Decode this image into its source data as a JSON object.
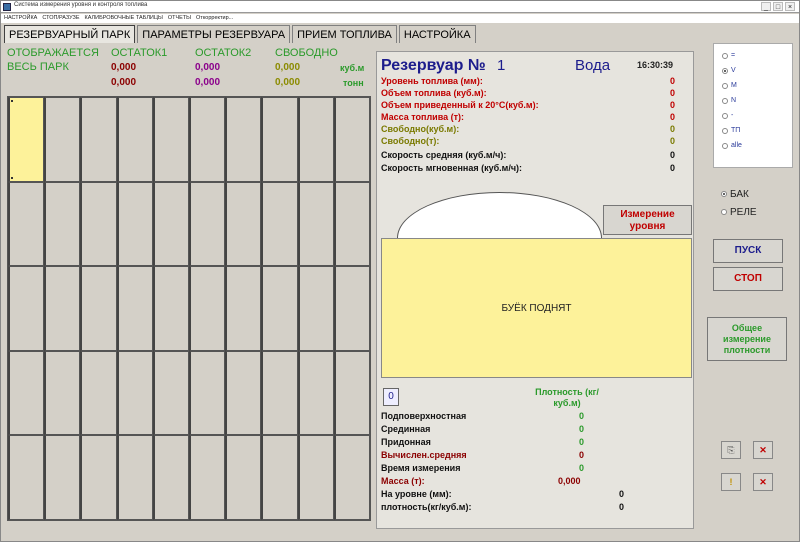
{
  "window": {
    "title": "Система измерения уровня и контроля топлива"
  },
  "menu": [
    "НАСТРОЙКА",
    "СТОП/РАЗУЗЕ",
    "КАЛИБРОВОЧНЫЕ ТАБЛИЦЫ",
    "ОТЧЕТЫ",
    "Откорректир..."
  ],
  "window_buttons": {
    "min": "_",
    "max": "□",
    "close": "×"
  },
  "tabs": [
    {
      "label": "РЕЗЕРВУАРНЫЙ ПАРК",
      "active": true
    },
    {
      "label": "ПАРАМЕТРЫ РЕЗЕРВУАРА",
      "active": false
    },
    {
      "label": "ПРИЕМ ТОПЛИВА",
      "active": false
    },
    {
      "label": "НАСТРОЙКА",
      "active": false
    }
  ],
  "summary": {
    "display_label": "ОТОБРАЖАЕТСЯ",
    "scope_label": "ВЕСЬ ПАРК",
    "col1": "ОСТАТОК1",
    "col2": "ОСТАТОК2",
    "col3": "СВОБОДНО",
    "row1": {
      "v1": "0,000",
      "v2": "0,000",
      "v3": "0,000",
      "unit": "куб.м"
    },
    "row2": {
      "v1": "0,000",
      "v2": "0,000",
      "v3": "0,000",
      "unit": "тонн"
    }
  },
  "grid": {
    "selected_index": 0
  },
  "reservoir": {
    "label": "Резервуар №",
    "number": "1",
    "product": "Вода",
    "time": "16:30:39",
    "params": [
      {
        "label": "Уровень топлива (мм):",
        "value": "0",
        "color": "red"
      },
      {
        "label": "Объем топлива (куб.м):",
        "value": "0",
        "color": "red"
      },
      {
        "label": "Объем приведенный к 20°С(куб.м):",
        "value": "0",
        "color": "red"
      },
      {
        "label": "Масса топлива (т):",
        "value": "0",
        "color": "red"
      },
      {
        "label": "Свободно(куб.м):",
        "value": "0",
        "color": "olive"
      },
      {
        "label": "Свободно(т):",
        "value": "0",
        "color": "olive"
      },
      {
        "label": "Скорость средняя (куб.м/ч):",
        "value": "0",
        "color": "black"
      },
      {
        "label": "Скорость мгновенная (куб.м/ч):",
        "value": "0",
        "color": "black"
      }
    ],
    "measure_button": "Измерение уровня",
    "tank_status": "БУЁК ПОДНЯТ"
  },
  "density": {
    "selector_value": "0",
    "header": "Плотность (кг/куб.м)",
    "rows": [
      {
        "label": "Подповерхностная",
        "value": "0",
        "color": "black"
      },
      {
        "label": "Срединная",
        "value": "0",
        "color": "black"
      },
      {
        "label": "Придонная",
        "value": "0",
        "color": "black"
      },
      {
        "label": "Вычислен.средняя",
        "value": "0",
        "color": "darkred"
      },
      {
        "label": "Время измерения",
        "value": "0",
        "color": "black"
      }
    ],
    "mass_label": "Масса (т):",
    "mass_value": "0,000",
    "level_label": "На уровне (мм):",
    "level_value": "0",
    "density_label": "плотность(кг/куб.м):",
    "density_value": "0"
  },
  "radio_options": [
    {
      "label": "=",
      "checked": false
    },
    {
      "label": "V",
      "checked": true
    },
    {
      "label": "M",
      "checked": false
    },
    {
      "label": "N",
      "checked": false
    },
    {
      "label": "-",
      "checked": false
    },
    {
      "label": "ТП",
      "checked": false
    },
    {
      "label": "alle",
      "checked": false
    }
  ],
  "mode": {
    "option1": "БАК",
    "option2": "РЕЛЕ",
    "selected": "option1"
  },
  "buttons": {
    "start": "ПУСК",
    "stop": "СТОП",
    "general_density": "Общее измерение плотности",
    "small_a": "⎘",
    "small_b": "✕",
    "small_c": "!",
    "small_d": "✕"
  },
  "colors": {
    "green": "#2b9a2b",
    "red": "#c00000",
    "navy": "#1c1c8c",
    "tank_yellow": "#fdf29a"
  }
}
